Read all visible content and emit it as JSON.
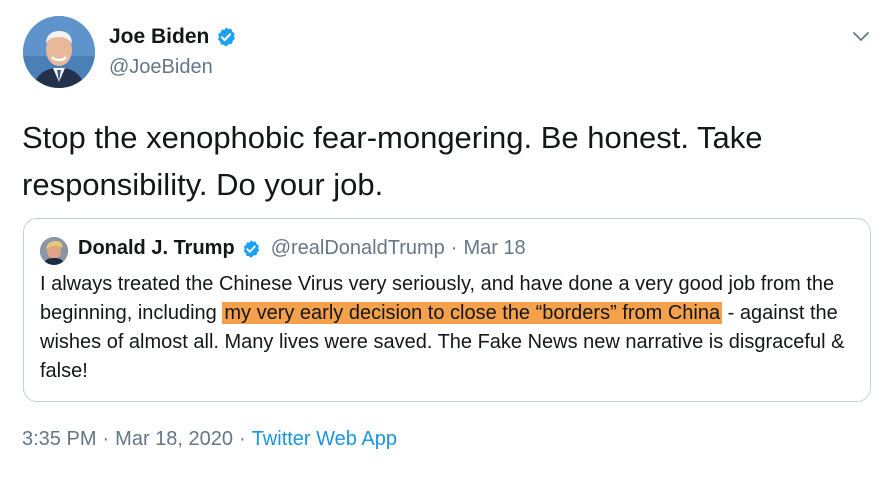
{
  "author": {
    "name": "Joe Biden",
    "handle": "@JoeBiden"
  },
  "tweet": {
    "text": "Stop the xenophobic fear-mongering. Be honest. Take responsibility. Do your job."
  },
  "quoted": {
    "name": "Donald J. Trump",
    "handle": "@realDonaldTrump",
    "separator": "·",
    "date": "Mar 18",
    "text_before": "I always treated the Chinese Virus very seriously, and have done a very good job from the beginning, including ",
    "text_highlight": "my very early decision to close the “borders” from China",
    "text_after": " - against the wishes of almost all. Many lives were saved. The Fake News new narrative is disgraceful & false!"
  },
  "meta": {
    "time": "3:35 PM",
    "separator": "·",
    "date": "Mar 18, 2020",
    "source": "Twitter Web App"
  },
  "colors": {
    "verified": "#1da1f2",
    "highlight": "#f5a04a",
    "link": "#1b95e0",
    "secondary_text": "#657786"
  },
  "icons": {
    "verified": "verified-badge-icon",
    "caret": "chevron-down-icon"
  }
}
